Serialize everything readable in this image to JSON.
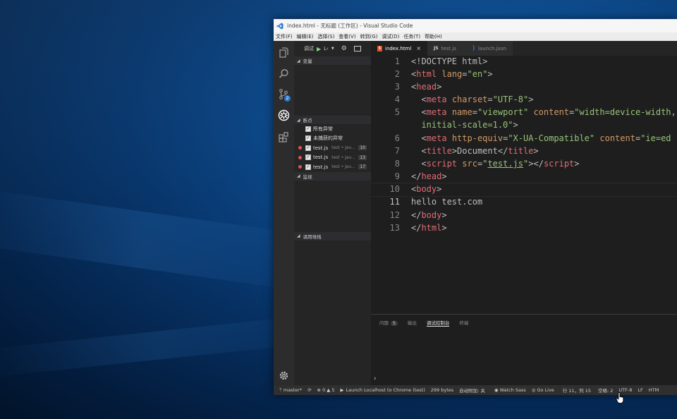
{
  "window": {
    "title": "index.html - 无标题 (工作区) - Visual Studio Code"
  },
  "menu": [
    "文件(F)",
    "编辑(E)",
    "选择(S)",
    "查看(V)",
    "转到(G)",
    "调试(D)",
    "任务(T)",
    "帮助(H)"
  ],
  "activity": {
    "scm_badge": "2"
  },
  "sidebar": {
    "debug_label": "调试",
    "config_short": "L‹",
    "variables_title": "变量",
    "breakpoints_title": "断点",
    "watch_title": "监视",
    "callstack_title": "调用堆栈",
    "all_exceptions": "所有异常",
    "uncaught_exceptions": "未捕获的异常",
    "breakpoints": [
      {
        "file": "test.js",
        "path": "test • Jav...",
        "line": "10"
      },
      {
        "file": "test.js",
        "path": "test • Jav...",
        "line": "13"
      },
      {
        "file": "test.js",
        "path": "test • Jav...",
        "line": "17"
      }
    ]
  },
  "tabs": [
    {
      "icon": "5",
      "label": "index.html",
      "close": "×"
    },
    {
      "icon": "JS",
      "label": "test.js"
    },
    {
      "icon": "⟩",
      "label": "launch.json"
    }
  ],
  "code": {
    "line_numbers": [
      "1",
      "2",
      "3",
      "4",
      "5",
      "",
      "6",
      "7",
      "8",
      "9",
      "10",
      "11",
      "12",
      "13"
    ],
    "current_line": "11",
    "l1": "<!DOCTYPE html>",
    "t_html": "html",
    "lang_attr": "lang",
    "lang_val": "\"en\"",
    "t_head": "head",
    "t_meta": "meta",
    "charset_attr": "charset",
    "charset_val": "\"UTF-8\"",
    "name_attr": "name",
    "name_val": "\"viewport\"",
    "content_attr": "content",
    "content_val": "\"width=device-width,",
    "content_val2": "initial-scale=1.0\"",
    "httpequiv_attr": "http-equiv",
    "httpequiv_val": "\"X-UA-Compatible\"",
    "content_val3": "\"ie=ed",
    "t_title": "title",
    "title_text": "Document",
    "t_script": "script",
    "src_attr": "src",
    "src_q1": "\"",
    "src_val": "test.js",
    "src_q2": "\"",
    "t_body": "body",
    "body_text": "hello test.com"
  },
  "panel": {
    "problems": "问题",
    "problems_count": "5",
    "output": "输出",
    "debug_console": "调试控制台",
    "terminal": "终端",
    "prompt": "›"
  },
  "status": {
    "branch": "master*",
    "errors": "0",
    "warnings": "5",
    "launch": "Launch Localhost to Chrome (test)",
    "bytes": "299 bytes",
    "autosave": "自动附加: 关",
    "watch_sass": "Watch Sass",
    "go_live": "Go Live",
    "position": "行 11，列 15",
    "spaces": "空格: 2",
    "encoding": "UTF-8",
    "eol": "LF",
    "language": "HTM"
  }
}
